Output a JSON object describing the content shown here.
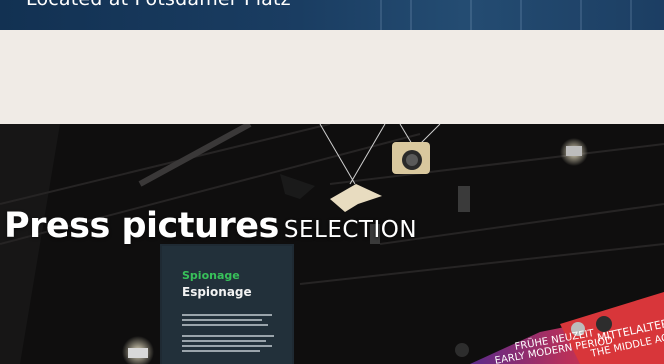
{
  "banner": {
    "location_text": "Located at Potsdamer Platz"
  },
  "hero": {
    "title_main": "Press pictures",
    "title_sub": "SELECTION",
    "panel": {
      "heading_de": "Spionage",
      "heading_en": "Espionage"
    },
    "wall_labels": {
      "period_de": "FRÜHE NEUZEIT",
      "period_en": "EARLY MODERN PERIOD",
      "middle_de": "MITTELALTER",
      "middle_en": "THE MIDDLE AGES"
    }
  },
  "colors": {
    "banner": "#1a3d62",
    "page_bg": "#f0ebe6",
    "accent_green": "#38c15a",
    "wall_red": "#d83a3a"
  }
}
